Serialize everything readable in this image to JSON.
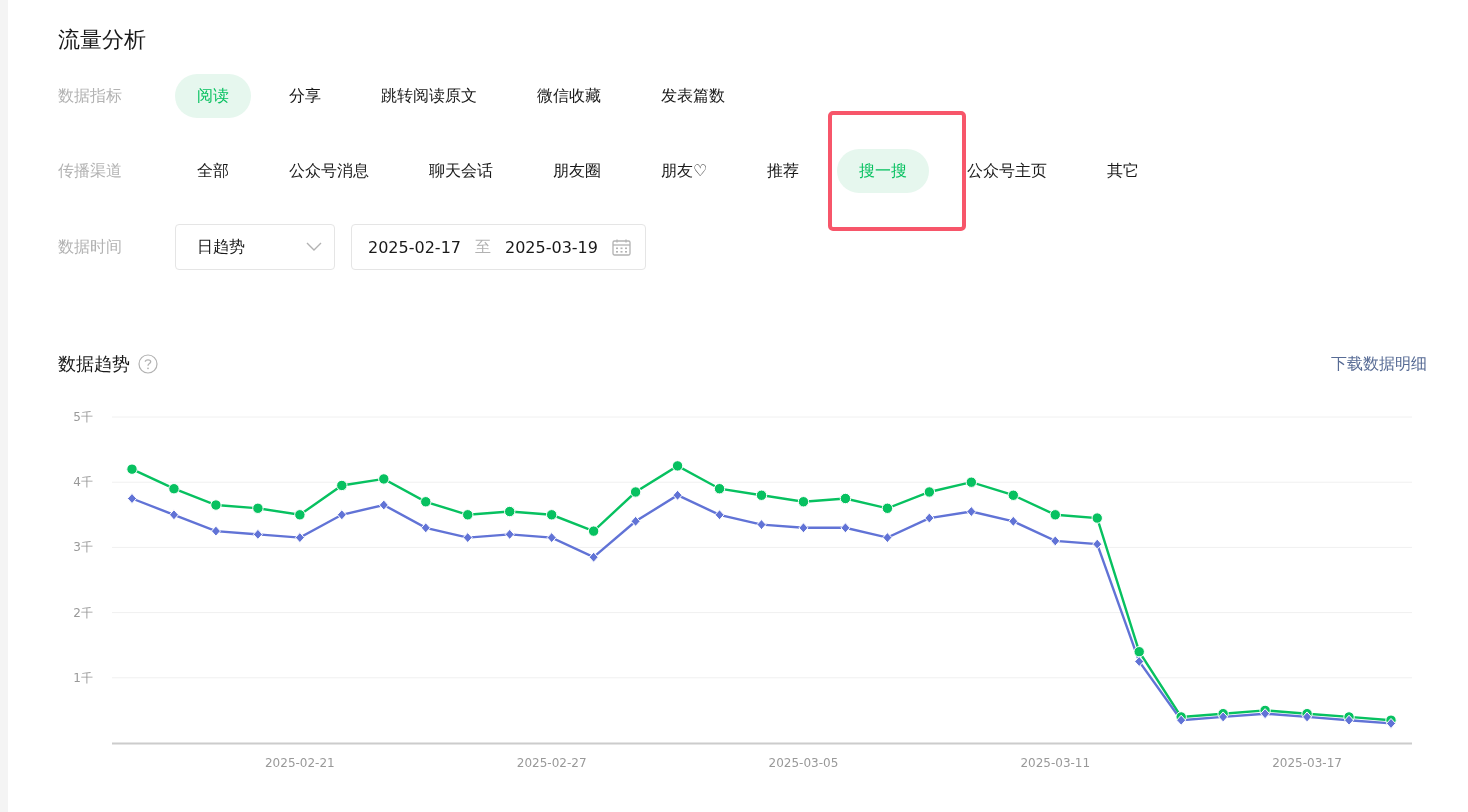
{
  "title": "流量分析",
  "metrics": {
    "label": "数据指标",
    "items": [
      {
        "label": "阅读",
        "selected": true
      },
      {
        "label": "分享",
        "selected": false
      },
      {
        "label": "跳转阅读原文",
        "selected": false
      },
      {
        "label": "微信收藏",
        "selected": false
      },
      {
        "label": "发表篇数",
        "selected": false
      }
    ]
  },
  "channels": {
    "label": "传播渠道",
    "items": [
      {
        "label": "全部",
        "selected": false,
        "highlighted": false
      },
      {
        "label": "公众号消息",
        "selected": false,
        "highlighted": false
      },
      {
        "label": "聊天会话",
        "selected": false,
        "highlighted": false
      },
      {
        "label": "朋友圈",
        "selected": false,
        "highlighted": false
      },
      {
        "label": "朋友♡",
        "selected": false,
        "highlighted": false
      },
      {
        "label": "推荐",
        "selected": false,
        "highlighted": false
      },
      {
        "label": "搜一搜",
        "selected": true,
        "highlighted": true
      },
      {
        "label": "公众号主页",
        "selected": false,
        "highlighted": false
      },
      {
        "label": "其它",
        "selected": false,
        "highlighted": false
      }
    ]
  },
  "time": {
    "label": "数据时间",
    "mode": "日趋势",
    "start": "2025-02-17",
    "separator": "至",
    "end": "2025-03-19"
  },
  "trend": {
    "title": "数据趋势",
    "download_link": "下载数据明细",
    "chart_data": {
      "type": "line",
      "grid": true,
      "ylim": [
        0,
        5
      ],
      "yticks": [
        {
          "value": 1,
          "label": "1千"
        },
        {
          "value": 2,
          "label": "2千"
        },
        {
          "value": 3,
          "label": "3千"
        },
        {
          "value": 4,
          "label": "4千"
        },
        {
          "value": 5,
          "label": "5千"
        }
      ],
      "categories": [
        null,
        null,
        null,
        null,
        "2025-02-21",
        null,
        null,
        null,
        null,
        null,
        "2025-02-27",
        null,
        null,
        null,
        null,
        null,
        "2025-03-05",
        null,
        null,
        null,
        null,
        null,
        "2025-03-11",
        null,
        null,
        null,
        null,
        null,
        "2025-03-17",
        null,
        null
      ],
      "series": [
        {
          "color": "#07c160",
          "marker": "circle",
          "values": [
            4.2,
            3.9,
            3.65,
            3.6,
            3.5,
            3.95,
            4.05,
            3.7,
            3.5,
            3.55,
            3.5,
            3.25,
            3.85,
            4.25,
            3.9,
            3.8,
            3.7,
            3.75,
            3.6,
            3.85,
            4.0,
            3.8,
            3.5,
            3.45,
            1.4,
            0.4,
            0.45,
            0.5,
            0.45,
            0.4,
            0.35
          ]
        },
        {
          "color": "#6173d6",
          "marker": "diamond",
          "values": [
            3.75,
            3.5,
            3.25,
            3.2,
            3.15,
            3.5,
            3.65,
            3.3,
            3.15,
            3.2,
            3.15,
            2.85,
            3.4,
            3.8,
            3.5,
            3.35,
            3.3,
            3.3,
            3.15,
            3.45,
            3.55,
            3.4,
            3.1,
            3.05,
            1.25,
            0.35,
            0.4,
            0.45,
            0.4,
            0.35,
            0.3
          ]
        }
      ]
    }
  }
}
